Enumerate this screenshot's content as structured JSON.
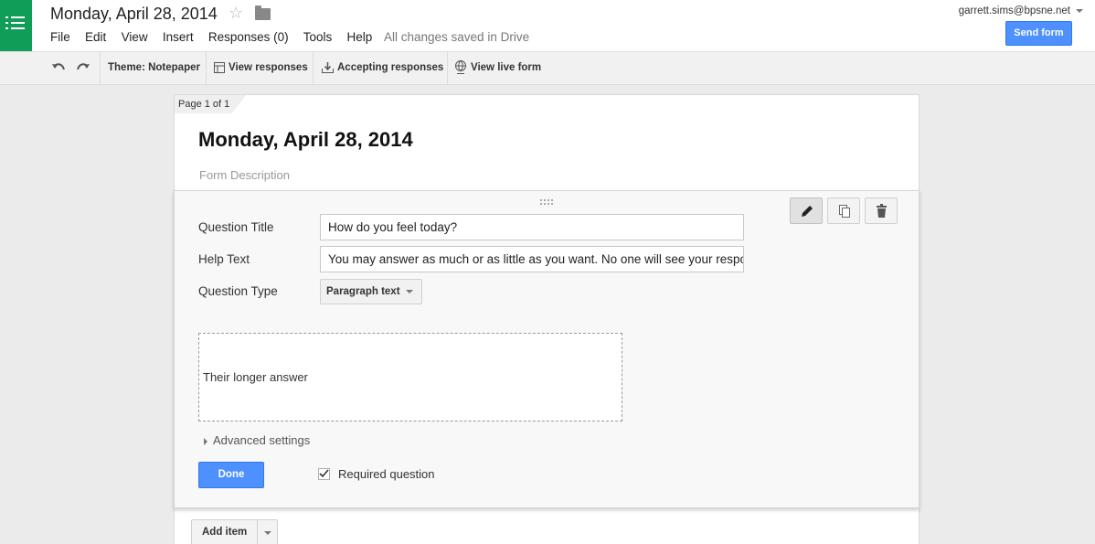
{
  "header": {
    "doc_title": "Monday, April 28, 2014",
    "menu": [
      "File",
      "Edit",
      "View",
      "Insert",
      "Responses (0)",
      "Tools",
      "Help"
    ],
    "save_status": "All changes saved in Drive",
    "account": "garrett.sims@bpsne.net",
    "send_label": "Send form",
    "accent_color": "#4d90fe",
    "brand_color": "#0f9d58"
  },
  "toolbar": {
    "theme": "Theme: Notepaper",
    "view_responses": "View responses",
    "accepting": "Accepting responses",
    "live_form": "View live form"
  },
  "form": {
    "page_tab": "Page 1 of 1",
    "title": "Monday, April 28, 2014",
    "description_placeholder": "Form Description"
  },
  "question": {
    "title_label": "Question Title",
    "title_value": "How do you feel today?",
    "help_label": "Help Text",
    "help_value": "You may answer as much or as little as you want. No one will see your respo",
    "type_label": "Question Type",
    "type_value": "Paragraph text",
    "answer_placeholder": "Their longer answer",
    "advanced_label": "Advanced settings",
    "done_label": "Done",
    "required_label": "Required question",
    "required_checked": true
  },
  "add_item": {
    "label": "Add item"
  }
}
